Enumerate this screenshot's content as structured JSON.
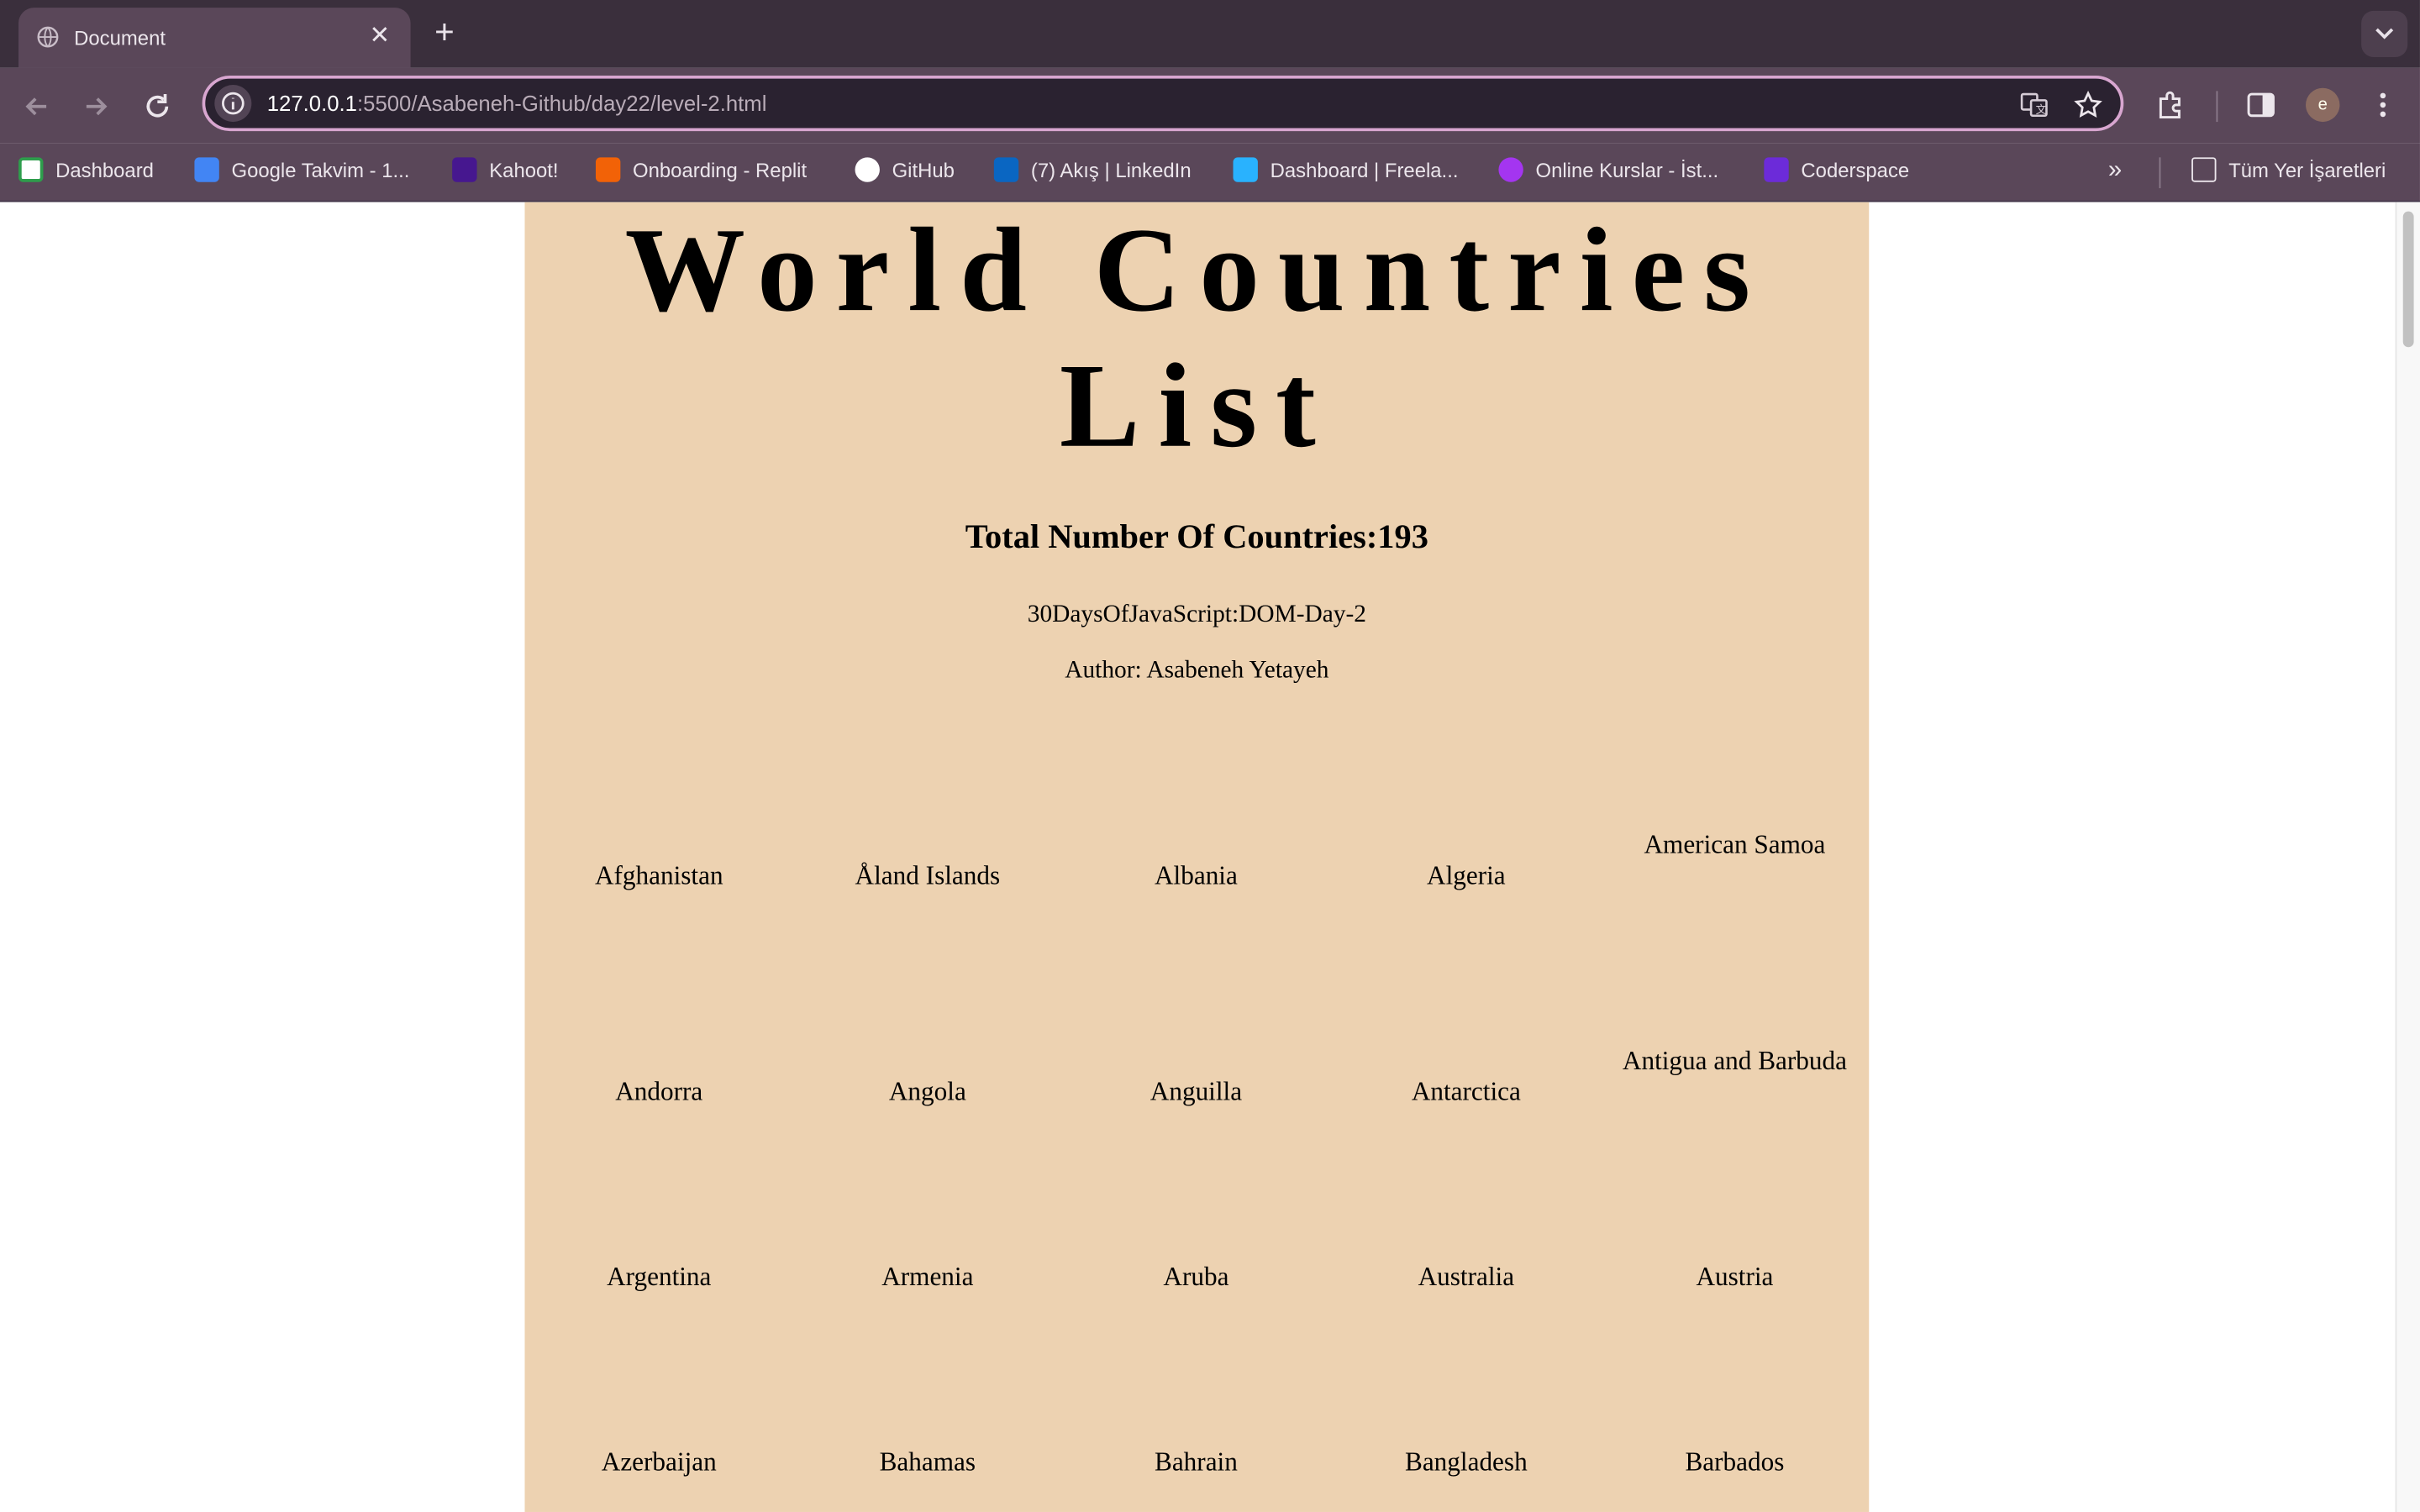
{
  "browser": {
    "tab_title": "Document",
    "url_host": "127.0.0.1",
    "url_rest": ":5500/Asabeneh-Github/day22/level-2.html",
    "profile_initial": "e",
    "bookmarks": [
      "Dashboard",
      "Google Takvim - 1...",
      "Kahoot!",
      "Onboarding - Replit",
      "GitHub",
      "(7) Akış | LinkedIn",
      "Dashboard | Freela...",
      "Online Kurslar - İst...",
      "Coderspace"
    ],
    "all_bookmarks": "Tüm Yer İşaretleri"
  },
  "page": {
    "title_line1": "World Countries",
    "title_line2": "List",
    "total_label": "Total Number Of Countries:193",
    "subtitle": "30DaysOfJavaScript:DOM-Day-2",
    "author": "Author: Asabeneh Yetayeh",
    "countries": [
      [
        "Afghanistan",
        "Åland Islands",
        "Albania",
        "Algeria",
        "American Samoa"
      ],
      [
        "Andorra",
        "Angola",
        "Anguilla",
        "Antarctica",
        "Antigua and Barbuda"
      ],
      [
        "Argentina",
        "Armenia",
        "Aruba",
        "Australia",
        "Austria"
      ],
      [
        "Azerbaijan",
        "Bahamas",
        "Bahrain",
        "Bangladesh",
        "Barbados"
      ]
    ]
  },
  "colors": {
    "page_background": "#edd2b1",
    "browser_frame": "#5a4759"
  }
}
